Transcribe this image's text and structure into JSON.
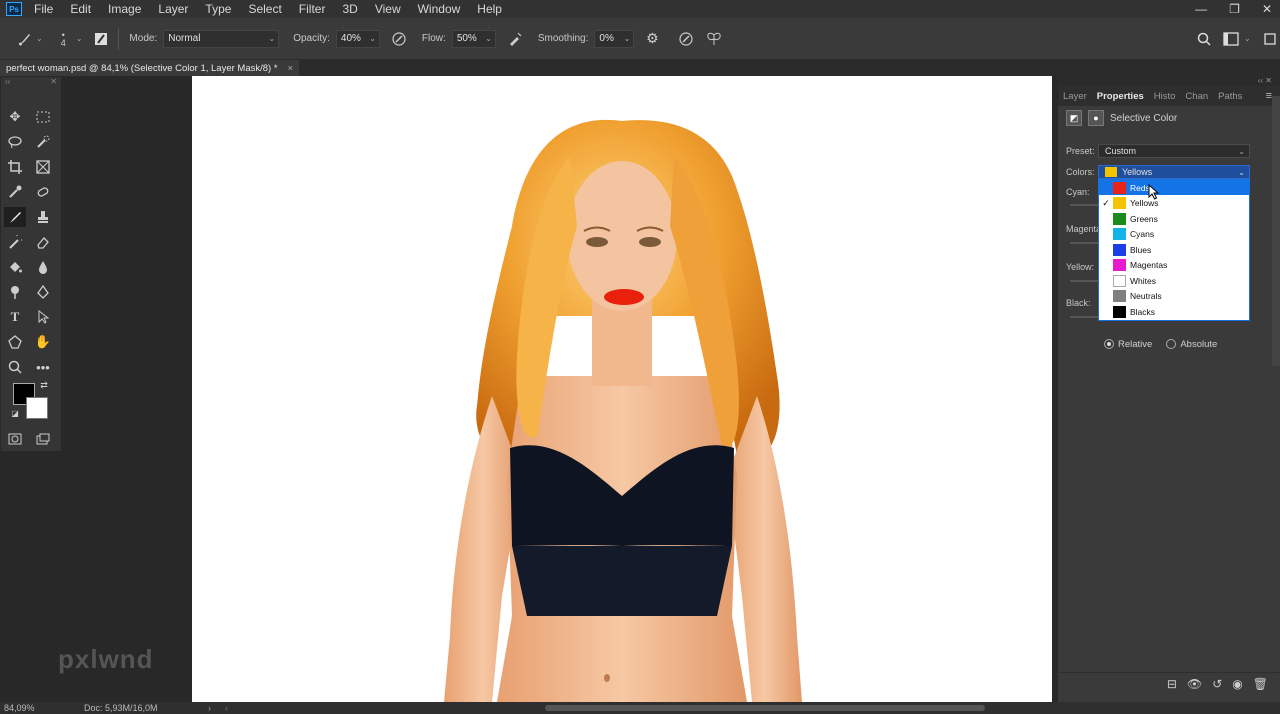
{
  "menu": {
    "logo": "Ps",
    "items": [
      "File",
      "Edit",
      "Image",
      "Layer",
      "Type",
      "Select",
      "Filter",
      "3D",
      "View",
      "Window",
      "Help"
    ],
    "window_controls": [
      "—",
      "❐",
      "✕"
    ]
  },
  "options": {
    "brush_size": "4",
    "mode_label": "Mode:",
    "mode_value": "Normal",
    "opacity_label": "Opacity:",
    "opacity_value": "40%",
    "flow_label": "Flow:",
    "flow_value": "50%",
    "smoothing_label": "Smoothing:",
    "smoothing_value": "0%"
  },
  "document": {
    "tab_title": "perfect woman.psd @ 84,1% (Selective Color 1, Layer Mask/8) *",
    "close": "×"
  },
  "status": {
    "zoom": "84,09%",
    "doc": "Doc: 5,93M/16,0M"
  },
  "watermark": "pxlwnd",
  "panel": {
    "tabs": [
      "Layer",
      "Properties",
      "Histo",
      "Chan",
      "Paths"
    ],
    "active_tab": "Properties",
    "title": "Selective Color",
    "preset_label": "Preset:",
    "preset_value": "Custom",
    "colors_label": "Colors:",
    "colors_value": "Yellows",
    "colors_value_swatch": "#f5c400",
    "sliders": [
      "Cyan:",
      "Magenta:",
      "Yellow:",
      "Black:"
    ],
    "method_options": [
      "Relative",
      "Absolute"
    ],
    "method_selected": "Relative"
  },
  "dropdown": {
    "items": [
      {
        "label": "Reds",
        "color": "#e8231a",
        "checked": false,
        "highlighted": true
      },
      {
        "label": "Yellows",
        "color": "#f5c400",
        "checked": true,
        "highlighted": false
      },
      {
        "label": "Greens",
        "color": "#1a8a1a",
        "checked": false,
        "highlighted": false
      },
      {
        "label": "Cyans",
        "color": "#10b4e8",
        "checked": false,
        "highlighted": false
      },
      {
        "label": "Blues",
        "color": "#1a3ee8",
        "checked": false,
        "highlighted": false
      },
      {
        "label": "Magentas",
        "color": "#e81ad0",
        "checked": false,
        "highlighted": false
      },
      {
        "label": "Whites",
        "color": "#ffffff",
        "checked": false,
        "highlighted": false
      },
      {
        "label": "Neutrals",
        "color": "#808080",
        "checked": false,
        "highlighted": false
      },
      {
        "label": "Blacks",
        "color": "#000000",
        "checked": false,
        "highlighted": false
      }
    ]
  }
}
